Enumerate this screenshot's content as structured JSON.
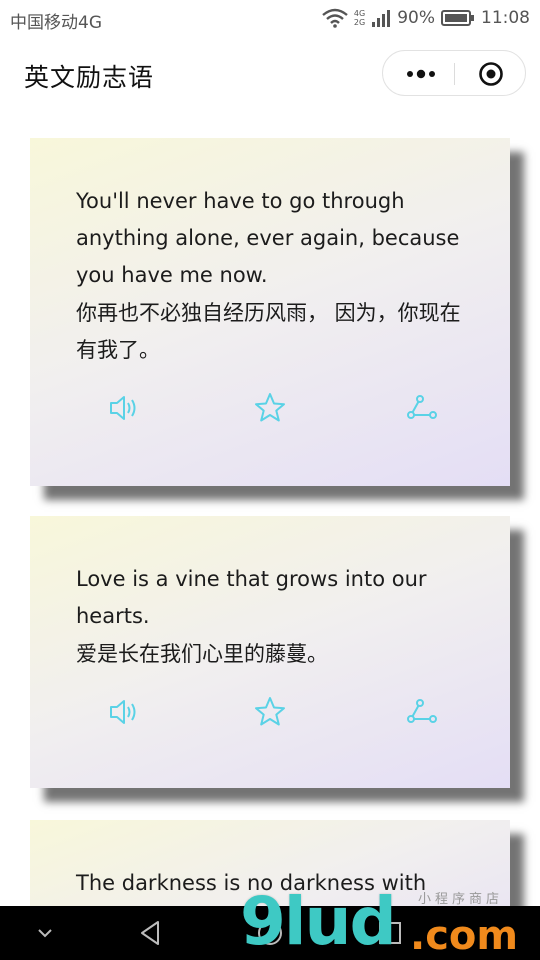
{
  "status_bar": {
    "carrier": "中国移动4G",
    "net_tag_top": "4G",
    "net_tag_bottom": "2G",
    "battery": "90%",
    "time": "11:08",
    "icons": [
      "wifi-icon",
      "signal-icon",
      "battery-icon"
    ]
  },
  "header": {
    "title": "英文励志语",
    "menu_icon": "more-dots-icon",
    "close_icon": "target-circle-icon"
  },
  "cards": [
    {
      "english": "You'll never have to go through anything alone, ever again, because you have me now.",
      "chinese": "你再也不必独自经历风雨， 因为，你现在有我了。",
      "actions": [
        "speaker-icon",
        "star-icon",
        "share-icon"
      ]
    },
    {
      "english": "Love is a vine that grows into our hearts.",
      "chinese": "爱是长在我们心里的藤蔓。",
      "actions": [
        "speaker-icon",
        "star-icon",
        "share-icon"
      ]
    },
    {
      "english": "The darkness is no darkness with",
      "chinese": "",
      "actions": []
    }
  ],
  "colors": {
    "icon_accent": "#5ad2e6",
    "card_gradient_start": "#f8f7da",
    "card_gradient_end": "#e4def5",
    "nav_bar": "#000000"
  },
  "nav": {
    "icons": [
      "chevron-down-icon",
      "back-triangle-icon",
      "home-circle-icon",
      "recent-square-icon"
    ]
  },
  "watermark": {
    "brand": "9lud",
    "suffix": ".com",
    "small_text": "小程序商店"
  }
}
